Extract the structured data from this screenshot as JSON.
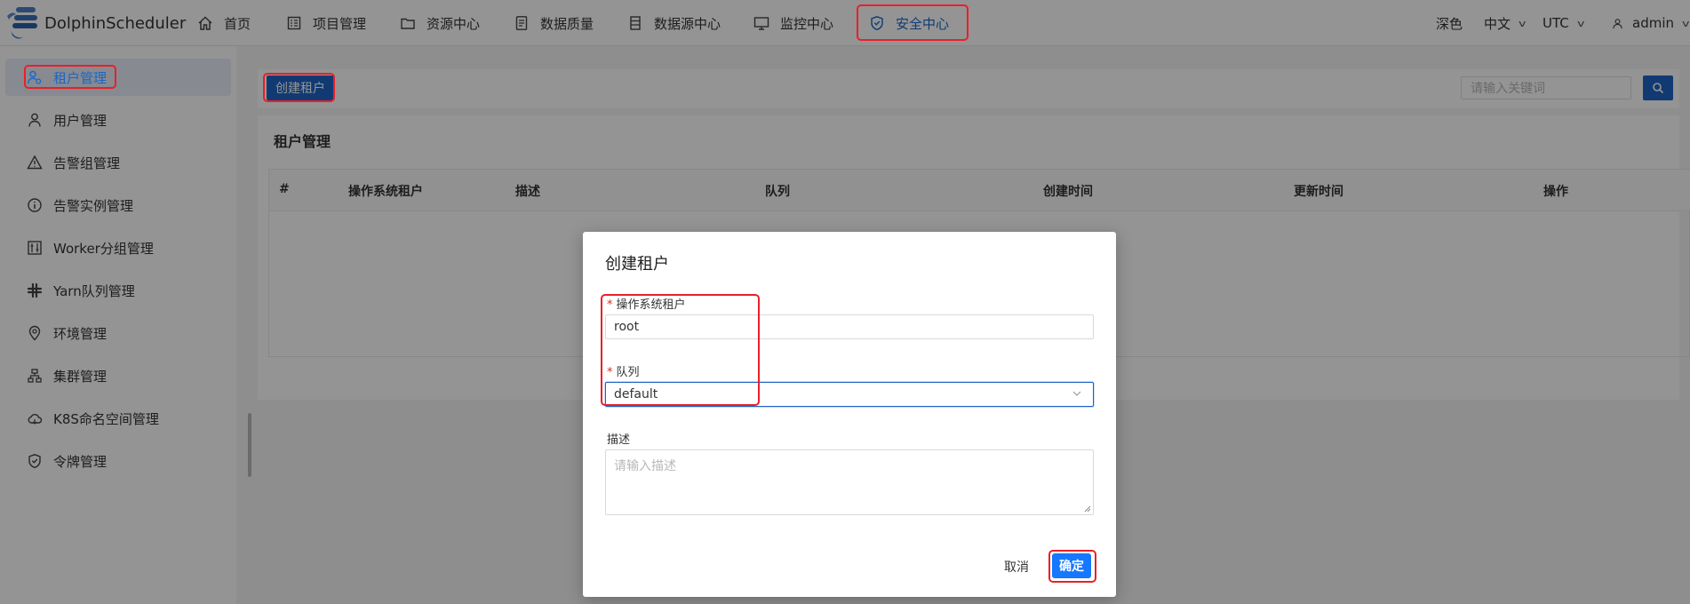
{
  "app": {
    "name": "DolphinScheduler"
  },
  "nav": {
    "items": [
      {
        "label": "首页",
        "icon": "home-icon"
      },
      {
        "label": "项目管理",
        "icon": "project-icon"
      },
      {
        "label": "资源中心",
        "icon": "folder-icon"
      },
      {
        "label": "数据质量",
        "icon": "data-quality-icon"
      },
      {
        "label": "数据源中心",
        "icon": "datasource-icon"
      },
      {
        "label": "监控中心",
        "icon": "monitor-icon"
      },
      {
        "label": "安全中心",
        "icon": "shield-icon",
        "active": true
      }
    ],
    "theme_label": "深色",
    "language_label": "中文",
    "timezone_label": "UTC",
    "user_label": "admin"
  },
  "sidebar": {
    "items": [
      {
        "label": "租户管理",
        "icon": "tenant-icon",
        "active": true
      },
      {
        "label": "用户管理",
        "icon": "user-icon"
      },
      {
        "label": "告警组管理",
        "icon": "warning-icon"
      },
      {
        "label": "告警实例管理",
        "icon": "info-icon"
      },
      {
        "label": "Worker分组管理",
        "icon": "worker-group-icon"
      },
      {
        "label": "Yarn队列管理",
        "icon": "yarn-icon"
      },
      {
        "label": "环境管理",
        "icon": "location-icon"
      },
      {
        "label": "集群管理",
        "icon": "cluster-icon"
      },
      {
        "label": "K8S命名空间管理",
        "icon": "cloud-icon"
      },
      {
        "label": "令牌管理",
        "icon": "token-icon"
      }
    ]
  },
  "toolbar": {
    "create_button": "创建租户",
    "search_placeholder": "请输入关键词"
  },
  "table": {
    "title": "租户管理",
    "columns": [
      "#",
      "操作系统租户",
      "描述",
      "队列",
      "创建时间",
      "更新时间",
      "操作"
    ]
  },
  "modal": {
    "title": "创建租户",
    "tenant_label": "操作系统租户",
    "tenant_value": "root",
    "queue_label": "队列",
    "queue_value": "default",
    "description_label": "描述",
    "description_placeholder": "请输入描述",
    "cancel_label": "取消",
    "confirm_label": "确定"
  },
  "colors": {
    "primary": "#1f64c5",
    "highlight_box": "#e8202a",
    "confirm": "#1677ff"
  }
}
